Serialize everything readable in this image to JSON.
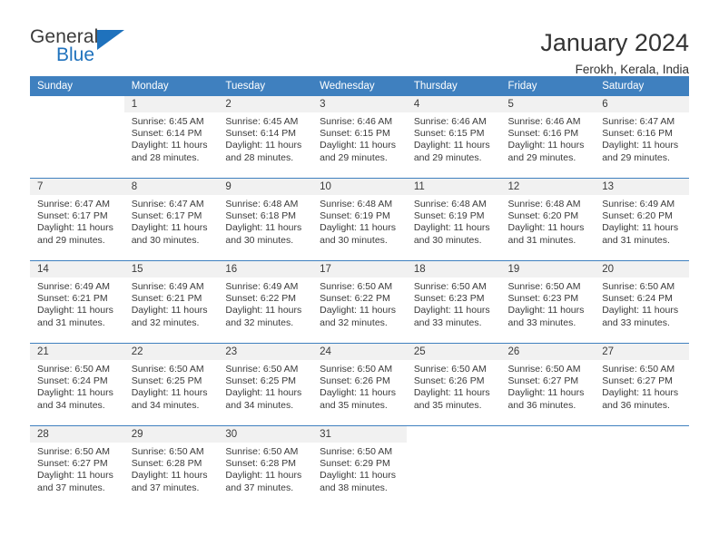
{
  "brand": {
    "word_one": "General",
    "word_two": "Blue",
    "accent_color": "#1f72bd"
  },
  "header": {
    "title": "January 2024",
    "subtitle": "Ferokh, Kerala, India"
  },
  "theme": {
    "header_row_bg": "#3f80bf",
    "daynum_bg": "#f1f1f1",
    "text_color": "#3a3a3a"
  },
  "weekdays": [
    "Sunday",
    "Monday",
    "Tuesday",
    "Wednesday",
    "Thursday",
    "Friday",
    "Saturday"
  ],
  "weeks": [
    [
      {
        "day": ""
      },
      {
        "day": "1",
        "sunrise": "Sunrise: 6:45 AM",
        "sunset": "Sunset: 6:14 PM",
        "daylight_line1": "Daylight: 11 hours",
        "daylight_line2": "and 28 minutes."
      },
      {
        "day": "2",
        "sunrise": "Sunrise: 6:45 AM",
        "sunset": "Sunset: 6:14 PM",
        "daylight_line1": "Daylight: 11 hours",
        "daylight_line2": "and 28 minutes."
      },
      {
        "day": "3",
        "sunrise": "Sunrise: 6:46 AM",
        "sunset": "Sunset: 6:15 PM",
        "daylight_line1": "Daylight: 11 hours",
        "daylight_line2": "and 29 minutes."
      },
      {
        "day": "4",
        "sunrise": "Sunrise: 6:46 AM",
        "sunset": "Sunset: 6:15 PM",
        "daylight_line1": "Daylight: 11 hours",
        "daylight_line2": "and 29 minutes."
      },
      {
        "day": "5",
        "sunrise": "Sunrise: 6:46 AM",
        "sunset": "Sunset: 6:16 PM",
        "daylight_line1": "Daylight: 11 hours",
        "daylight_line2": "and 29 minutes."
      },
      {
        "day": "6",
        "sunrise": "Sunrise: 6:47 AM",
        "sunset": "Sunset: 6:16 PM",
        "daylight_line1": "Daylight: 11 hours",
        "daylight_line2": "and 29 minutes."
      }
    ],
    [
      {
        "day": "7",
        "sunrise": "Sunrise: 6:47 AM",
        "sunset": "Sunset: 6:17 PM",
        "daylight_line1": "Daylight: 11 hours",
        "daylight_line2": "and 29 minutes."
      },
      {
        "day": "8",
        "sunrise": "Sunrise: 6:47 AM",
        "sunset": "Sunset: 6:17 PM",
        "daylight_line1": "Daylight: 11 hours",
        "daylight_line2": "and 30 minutes."
      },
      {
        "day": "9",
        "sunrise": "Sunrise: 6:48 AM",
        "sunset": "Sunset: 6:18 PM",
        "daylight_line1": "Daylight: 11 hours",
        "daylight_line2": "and 30 minutes."
      },
      {
        "day": "10",
        "sunrise": "Sunrise: 6:48 AM",
        "sunset": "Sunset: 6:19 PM",
        "daylight_line1": "Daylight: 11 hours",
        "daylight_line2": "and 30 minutes."
      },
      {
        "day": "11",
        "sunrise": "Sunrise: 6:48 AM",
        "sunset": "Sunset: 6:19 PM",
        "daylight_line1": "Daylight: 11 hours",
        "daylight_line2": "and 30 minutes."
      },
      {
        "day": "12",
        "sunrise": "Sunrise: 6:48 AM",
        "sunset": "Sunset: 6:20 PM",
        "daylight_line1": "Daylight: 11 hours",
        "daylight_line2": "and 31 minutes."
      },
      {
        "day": "13",
        "sunrise": "Sunrise: 6:49 AM",
        "sunset": "Sunset: 6:20 PM",
        "daylight_line1": "Daylight: 11 hours",
        "daylight_line2": "and 31 minutes."
      }
    ],
    [
      {
        "day": "14",
        "sunrise": "Sunrise: 6:49 AM",
        "sunset": "Sunset: 6:21 PM",
        "daylight_line1": "Daylight: 11 hours",
        "daylight_line2": "and 31 minutes."
      },
      {
        "day": "15",
        "sunrise": "Sunrise: 6:49 AM",
        "sunset": "Sunset: 6:21 PM",
        "daylight_line1": "Daylight: 11 hours",
        "daylight_line2": "and 32 minutes."
      },
      {
        "day": "16",
        "sunrise": "Sunrise: 6:49 AM",
        "sunset": "Sunset: 6:22 PM",
        "daylight_line1": "Daylight: 11 hours",
        "daylight_line2": "and 32 minutes."
      },
      {
        "day": "17",
        "sunrise": "Sunrise: 6:50 AM",
        "sunset": "Sunset: 6:22 PM",
        "daylight_line1": "Daylight: 11 hours",
        "daylight_line2": "and 32 minutes."
      },
      {
        "day": "18",
        "sunrise": "Sunrise: 6:50 AM",
        "sunset": "Sunset: 6:23 PM",
        "daylight_line1": "Daylight: 11 hours",
        "daylight_line2": "and 33 minutes."
      },
      {
        "day": "19",
        "sunrise": "Sunrise: 6:50 AM",
        "sunset": "Sunset: 6:23 PM",
        "daylight_line1": "Daylight: 11 hours",
        "daylight_line2": "and 33 minutes."
      },
      {
        "day": "20",
        "sunrise": "Sunrise: 6:50 AM",
        "sunset": "Sunset: 6:24 PM",
        "daylight_line1": "Daylight: 11 hours",
        "daylight_line2": "and 33 minutes."
      }
    ],
    [
      {
        "day": "21",
        "sunrise": "Sunrise: 6:50 AM",
        "sunset": "Sunset: 6:24 PM",
        "daylight_line1": "Daylight: 11 hours",
        "daylight_line2": "and 34 minutes."
      },
      {
        "day": "22",
        "sunrise": "Sunrise: 6:50 AM",
        "sunset": "Sunset: 6:25 PM",
        "daylight_line1": "Daylight: 11 hours",
        "daylight_line2": "and 34 minutes."
      },
      {
        "day": "23",
        "sunrise": "Sunrise: 6:50 AM",
        "sunset": "Sunset: 6:25 PM",
        "daylight_line1": "Daylight: 11 hours",
        "daylight_line2": "and 34 minutes."
      },
      {
        "day": "24",
        "sunrise": "Sunrise: 6:50 AM",
        "sunset": "Sunset: 6:26 PM",
        "daylight_line1": "Daylight: 11 hours",
        "daylight_line2": "and 35 minutes."
      },
      {
        "day": "25",
        "sunrise": "Sunrise: 6:50 AM",
        "sunset": "Sunset: 6:26 PM",
        "daylight_line1": "Daylight: 11 hours",
        "daylight_line2": "and 35 minutes."
      },
      {
        "day": "26",
        "sunrise": "Sunrise: 6:50 AM",
        "sunset": "Sunset: 6:27 PM",
        "daylight_line1": "Daylight: 11 hours",
        "daylight_line2": "and 36 minutes."
      },
      {
        "day": "27",
        "sunrise": "Sunrise: 6:50 AM",
        "sunset": "Sunset: 6:27 PM",
        "daylight_line1": "Daylight: 11 hours",
        "daylight_line2": "and 36 minutes."
      }
    ],
    [
      {
        "day": "28",
        "sunrise": "Sunrise: 6:50 AM",
        "sunset": "Sunset: 6:27 PM",
        "daylight_line1": "Daylight: 11 hours",
        "daylight_line2": "and 37 minutes."
      },
      {
        "day": "29",
        "sunrise": "Sunrise: 6:50 AM",
        "sunset": "Sunset: 6:28 PM",
        "daylight_line1": "Daylight: 11 hours",
        "daylight_line2": "and 37 minutes."
      },
      {
        "day": "30",
        "sunrise": "Sunrise: 6:50 AM",
        "sunset": "Sunset: 6:28 PM",
        "daylight_line1": "Daylight: 11 hours",
        "daylight_line2": "and 37 minutes."
      },
      {
        "day": "31",
        "sunrise": "Sunrise: 6:50 AM",
        "sunset": "Sunset: 6:29 PM",
        "daylight_line1": "Daylight: 11 hours",
        "daylight_line2": "and 38 minutes."
      },
      {
        "day": ""
      },
      {
        "day": ""
      },
      {
        "day": ""
      }
    ]
  ]
}
